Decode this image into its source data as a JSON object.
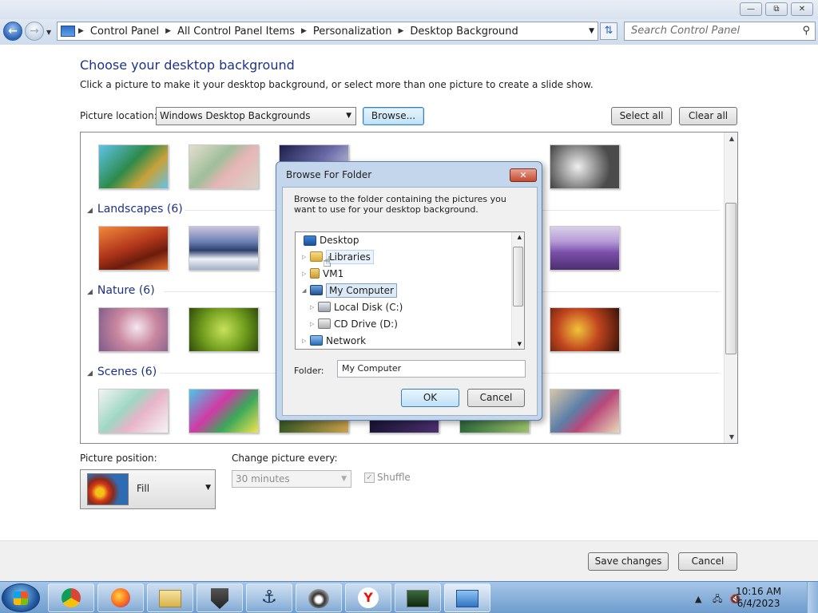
{
  "window": {
    "minimize_icon": "minimize-icon",
    "maximize_icon": "restore-icon",
    "close_icon": "close-icon"
  },
  "address": {
    "crumbs": [
      "Control Panel",
      "All Control Panel Items",
      "Personalization",
      "Desktop Background"
    ],
    "search_placeholder": "Search Control Panel"
  },
  "page": {
    "title": "Choose your desktop background",
    "subtitle": "Click a picture to make it your desktop background, or select more than one picture to create a slide show.",
    "location_label": "Picture location:",
    "location_value": "Windows Desktop Backgrounds",
    "browse_label": "Browse...",
    "select_all_label": "Select all",
    "clear_all_label": "Clear all"
  },
  "gallery": {
    "groups": [
      {
        "label": "Landscapes (6)"
      },
      {
        "label": "Nature (6)"
      },
      {
        "label": "Scenes (6)"
      }
    ]
  },
  "position": {
    "label": "Picture position:",
    "value": "Fill"
  },
  "slideshow": {
    "label": "Change picture every:",
    "value": "30 minutes",
    "shuffle_label": "Shuffle",
    "shuffle_checked": true
  },
  "footer": {
    "save_label": "Save changes",
    "cancel_label": "Cancel"
  },
  "dialog": {
    "title": "Browse For Folder",
    "description": "Browse to the folder containing the pictures you want to use for your desktop background.",
    "tree": [
      {
        "label": "Desktop",
        "icon": "desktop-icon"
      },
      {
        "label": "Libraries",
        "icon": "libraries-icon"
      },
      {
        "label": "VM1",
        "icon": "user-folder-icon"
      },
      {
        "label": "My Computer",
        "icon": "computer-icon"
      },
      {
        "label": "Local Disk (C:)",
        "icon": "drive-icon"
      },
      {
        "label": "CD Drive (D:)",
        "icon": "cd-drive-icon"
      },
      {
        "label": "Network",
        "icon": "network-icon"
      }
    ],
    "folder_label": "Folder:",
    "folder_value": "My Computer",
    "ok_label": "OK",
    "cancel_label": "Cancel"
  },
  "taskbar": {
    "time": "10:16 AM",
    "date": "6/4/2023"
  }
}
